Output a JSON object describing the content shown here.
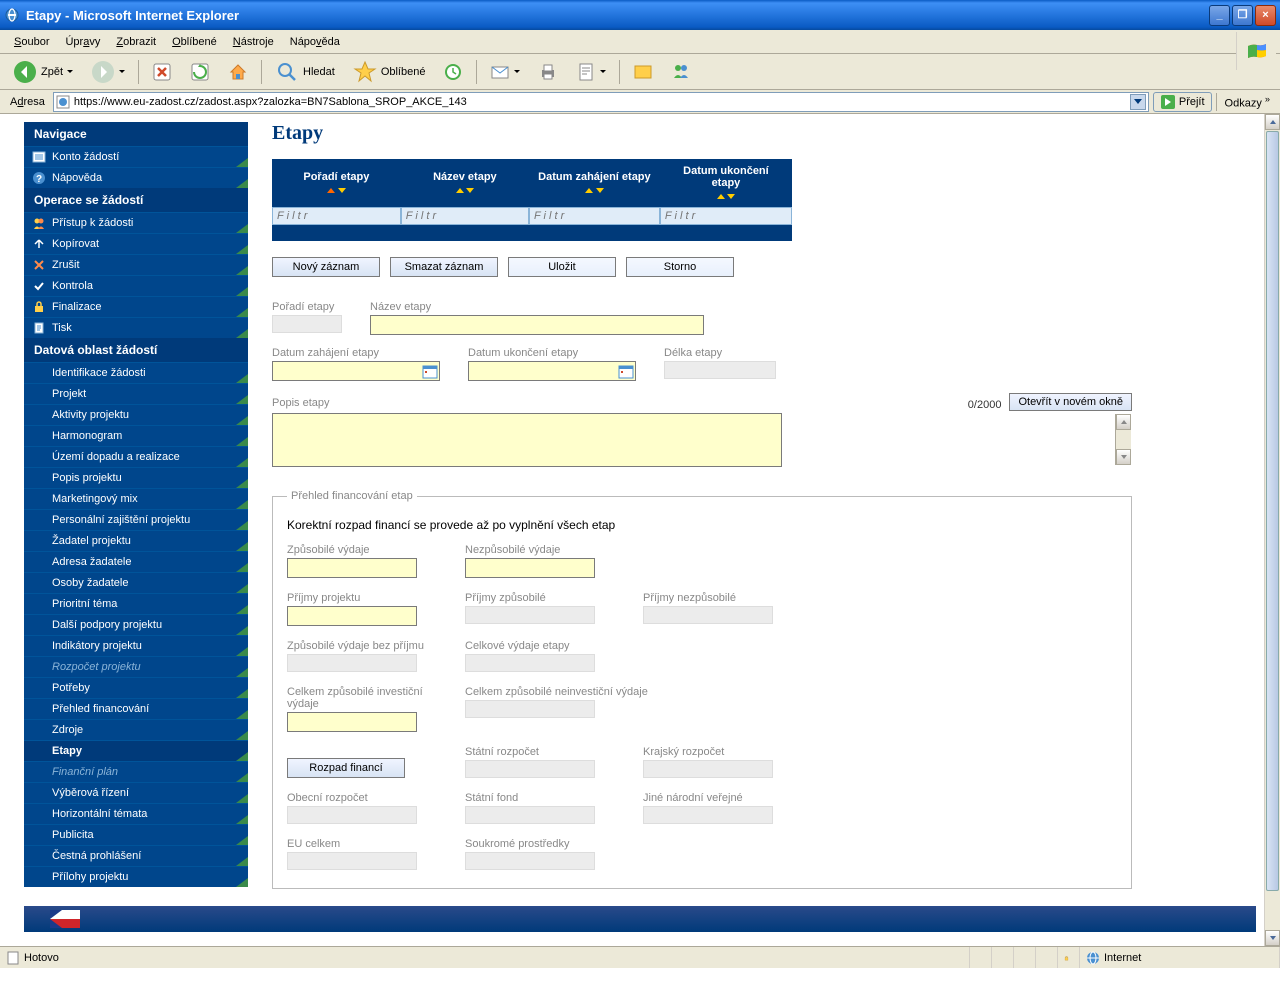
{
  "window": {
    "title": "Etapy - Microsoft Internet Explorer"
  },
  "menubar": {
    "items": [
      "Soubor",
      "Úpravy",
      "Zobrazit",
      "Oblíbené",
      "Nástroje",
      "Nápověda"
    ]
  },
  "toolbar": {
    "back": "Zpět",
    "search": "Hledat",
    "favorites": "Oblíbené"
  },
  "addressbar": {
    "label": "Adresa",
    "url": "https://www.eu-zadost.cz/zadost.aspx?zalozka=BN7Sablona_SROP_AKCE_143",
    "go": "Přejít",
    "links": "Odkazy"
  },
  "sidebar": {
    "hdr_nav": "Navigace",
    "hdr_ops": "Operace se žádostí",
    "hdr_data": "Datová oblast žádostí",
    "nav": [
      {
        "label": "Konto žádostí",
        "icon": "list"
      },
      {
        "label": "Nápověda",
        "icon": "help"
      }
    ],
    "ops": [
      {
        "label": "Přístup k žádosti",
        "icon": "users"
      },
      {
        "label": "Kopírovat",
        "icon": "copy"
      },
      {
        "label": "Zrušit",
        "icon": "cancel"
      },
      {
        "label": "Kontrola",
        "icon": "check"
      },
      {
        "label": "Finalizace",
        "icon": "lock"
      },
      {
        "label": "Tisk",
        "icon": "print"
      }
    ],
    "data_items": [
      {
        "label": "Identifikace žádosti"
      },
      {
        "label": "Projekt"
      },
      {
        "label": "Aktivity projektu"
      },
      {
        "label": "Harmonogram"
      },
      {
        "label": "Území dopadu a realizace"
      },
      {
        "label": "Popis projektu"
      },
      {
        "label": "Marketingový mix"
      },
      {
        "label": "Personální zajištění projektu"
      },
      {
        "label": "Žadatel projektu"
      },
      {
        "label": "Adresa žadatele"
      },
      {
        "label": "Osoby žadatele"
      },
      {
        "label": "Prioritní téma"
      },
      {
        "label": "Další podpory projektu"
      },
      {
        "label": "Indikátory projektu"
      },
      {
        "label": "Rozpočet projektu",
        "dim": true
      },
      {
        "label": "Potřeby"
      },
      {
        "label": "Přehled financování"
      },
      {
        "label": "Zdroje"
      },
      {
        "label": "Etapy",
        "active": true
      },
      {
        "label": "Finanční plán",
        "dim": true
      },
      {
        "label": "Výběrová řízení"
      },
      {
        "label": "Horizontální témata"
      },
      {
        "label": "Publicita"
      },
      {
        "label": "Čestná prohlášení"
      },
      {
        "label": "Přílohy projektu"
      }
    ]
  },
  "main": {
    "title": "Etapy",
    "table": {
      "cols": [
        "Pořadí etapy",
        "Název etapy",
        "Datum zahájení etapy",
        "Datum ukončení etapy"
      ],
      "filter_placeholder": "F i l t r"
    },
    "buttons": {
      "new": "Nový záznam",
      "delete": "Smazat záznam",
      "save": "Uložit",
      "cancel": "Storno"
    },
    "form": {
      "lbl_poradi": "Pořadí etapy",
      "lbl_nazev": "Název etapy",
      "lbl_datum_zahajeni": "Datum zahájení etapy",
      "lbl_datum_ukonceni": "Datum ukončení etapy",
      "lbl_delka": "Délka etapy",
      "lbl_popis": "Popis etapy",
      "char_count": "0/2000",
      "open_new": "Otevřít v novém okně"
    },
    "fieldset": {
      "legend": "Přehled financování etap",
      "note": "Korektní rozpad financí se provede až po vyplnění všech etap",
      "labels": {
        "zpusobile": "Způsobilé výdaje",
        "nezpusobile": "Nezpůsobilé výdaje",
        "prijmy_proj": "Příjmy projektu",
        "prijmy_zpus": "Příjmy způsobilé",
        "prijmy_nezpus": "Příjmy nezpůsobilé",
        "zpus_bez": "Způsobilé výdaje bez příjmu",
        "celkove": "Celkové výdaje etapy",
        "celk_inv": "Celkem způsobilé investiční výdaje",
        "celk_neinv": "Celkem způsobilé neinvestiční výdaje",
        "rozpad": "Rozpad financí",
        "statni_rozp": "Státní rozpočet",
        "krajsky": "Krajský rozpočet",
        "obecni": "Obecní rozpočet",
        "statni_fond": "Státní fond",
        "jine": "Jiné národní veřejné",
        "eu": "EU celkem",
        "soukrome": "Soukromé prostředky"
      }
    }
  },
  "statusbar": {
    "status": "Hotovo",
    "zone": "Internet"
  }
}
